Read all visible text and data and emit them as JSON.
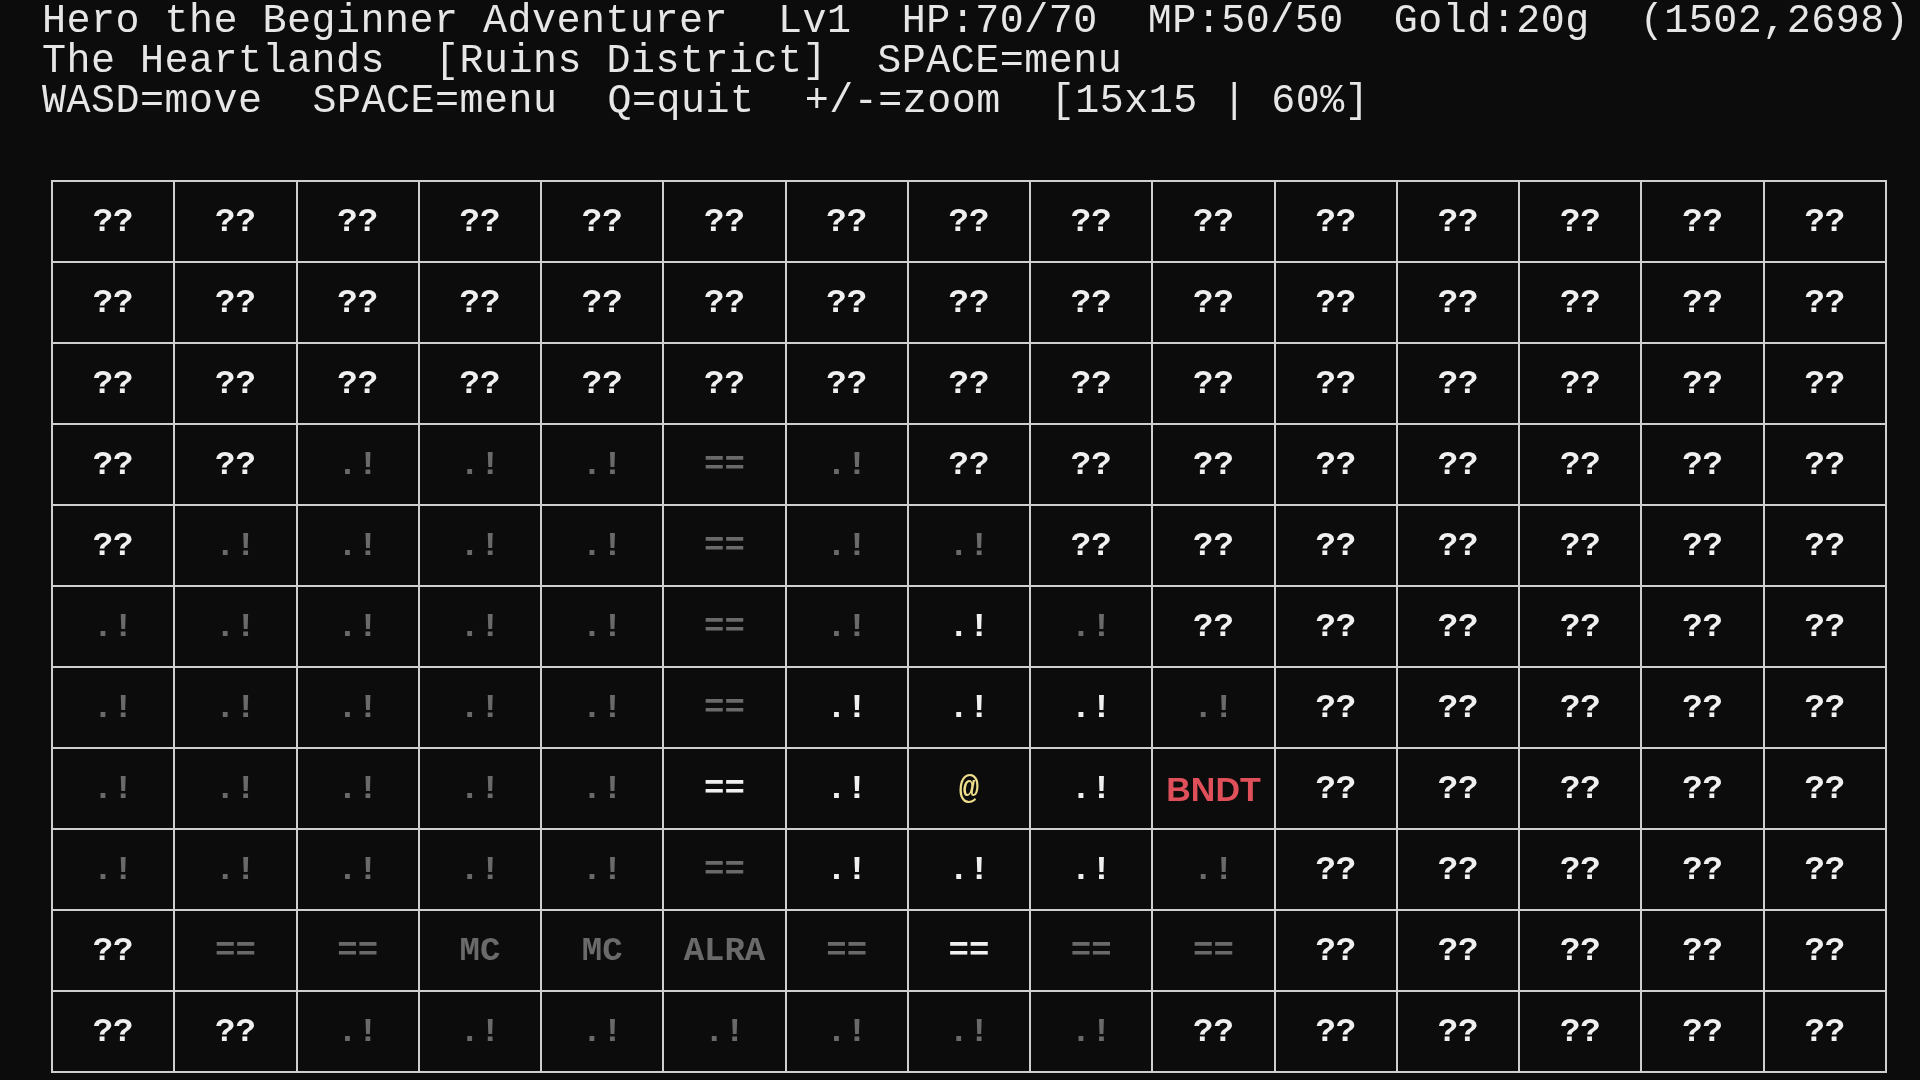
{
  "status_lines": [
    [
      "Hero the Beginner Adventurer",
      "Lv1",
      "HP:70/70",
      "MP:50/50",
      "Gold:20g",
      "(1502,2698)"
    ],
    [
      "The Heartlands",
      "[Ruins District]",
      "SPACE=menu"
    ],
    [
      "WASD=move",
      "SPACE=menu",
      "Q=quit",
      "+/-=zoom",
      "[15x15 | 60%]"
    ]
  ],
  "map": {
    "rows": [
      [
        {
          "text": "??",
          "kind": "tile",
          "visible": true
        },
        {
          "text": "??",
          "kind": "tile",
          "visible": true
        },
        {
          "text": "??",
          "kind": "tile",
          "visible": true
        },
        {
          "text": "??",
          "kind": "tile",
          "visible": true
        },
        {
          "text": "??",
          "kind": "tile",
          "visible": true
        },
        {
          "text": "??",
          "kind": "tile",
          "visible": true
        },
        {
          "text": "??",
          "kind": "tile",
          "visible": true
        },
        {
          "text": "??",
          "kind": "tile",
          "visible": true
        },
        {
          "text": "??",
          "kind": "tile",
          "visible": true
        },
        {
          "text": "??",
          "kind": "tile",
          "visible": true
        },
        {
          "text": "??",
          "kind": "tile",
          "visible": true
        },
        {
          "text": "??",
          "kind": "tile",
          "visible": true
        },
        {
          "text": "??",
          "kind": "tile",
          "visible": true
        },
        {
          "text": "??",
          "kind": "tile",
          "visible": true
        },
        {
          "text": "??",
          "kind": "tile",
          "visible": true
        }
      ],
      [
        {
          "text": "??",
          "kind": "tile",
          "visible": true
        },
        {
          "text": "??",
          "kind": "tile",
          "visible": true
        },
        {
          "text": "??",
          "kind": "tile",
          "visible": true
        },
        {
          "text": "??",
          "kind": "tile",
          "visible": true
        },
        {
          "text": "??",
          "kind": "tile",
          "visible": true
        },
        {
          "text": "??",
          "kind": "tile",
          "visible": true
        },
        {
          "text": "??",
          "kind": "tile",
          "visible": true
        },
        {
          "text": "??",
          "kind": "tile",
          "visible": true
        },
        {
          "text": "??",
          "kind": "tile",
          "visible": true
        },
        {
          "text": "??",
          "kind": "tile",
          "visible": true
        },
        {
          "text": "??",
          "kind": "tile",
          "visible": true
        },
        {
          "text": "??",
          "kind": "tile",
          "visible": true
        },
        {
          "text": "??",
          "kind": "tile",
          "visible": true
        },
        {
          "text": "??",
          "kind": "tile",
          "visible": true
        },
        {
          "text": "??",
          "kind": "tile",
          "visible": true
        }
      ],
      [
        {
          "text": "??",
          "kind": "tile",
          "visible": true
        },
        {
          "text": "??",
          "kind": "tile",
          "visible": true
        },
        {
          "text": "??",
          "kind": "tile",
          "visible": true
        },
        {
          "text": "??",
          "kind": "tile",
          "visible": true
        },
        {
          "text": "??",
          "kind": "tile",
          "visible": true
        },
        {
          "text": "??",
          "kind": "tile",
          "visible": true
        },
        {
          "text": "??",
          "kind": "tile",
          "visible": true
        },
        {
          "text": "??",
          "kind": "tile",
          "visible": true
        },
        {
          "text": "??",
          "kind": "tile",
          "visible": true
        },
        {
          "text": "??",
          "kind": "tile",
          "visible": true
        },
        {
          "text": "??",
          "kind": "tile",
          "visible": true
        },
        {
          "text": "??",
          "kind": "tile",
          "visible": true
        },
        {
          "text": "??",
          "kind": "tile",
          "visible": true
        },
        {
          "text": "??",
          "kind": "tile",
          "visible": true
        },
        {
          "text": "??",
          "kind": "tile",
          "visible": true
        }
      ],
      [
        {
          "text": "??",
          "kind": "tile",
          "visible": true
        },
        {
          "text": "??",
          "kind": "tile",
          "visible": true
        },
        {
          "text": ".!",
          "kind": "tile",
          "visible": false
        },
        {
          "text": ".!",
          "kind": "tile",
          "visible": false
        },
        {
          "text": ".!",
          "kind": "tile",
          "visible": false
        },
        {
          "text": "==",
          "kind": "tile",
          "visible": false
        },
        {
          "text": ".!",
          "kind": "tile",
          "visible": false
        },
        {
          "text": "??",
          "kind": "tile",
          "visible": true
        },
        {
          "text": "??",
          "kind": "tile",
          "visible": true
        },
        {
          "text": "??",
          "kind": "tile",
          "visible": true
        },
        {
          "text": "??",
          "kind": "tile",
          "visible": true
        },
        {
          "text": "??",
          "kind": "tile",
          "visible": true
        },
        {
          "text": "??",
          "kind": "tile",
          "visible": true
        },
        {
          "text": "??",
          "kind": "tile",
          "visible": true
        },
        {
          "text": "??",
          "kind": "tile",
          "visible": true
        }
      ],
      [
        {
          "text": "??",
          "kind": "tile",
          "visible": true
        },
        {
          "text": ".!",
          "kind": "tile",
          "visible": false
        },
        {
          "text": ".!",
          "kind": "tile",
          "visible": false
        },
        {
          "text": ".!",
          "kind": "tile",
          "visible": false
        },
        {
          "text": ".!",
          "kind": "tile",
          "visible": false
        },
        {
          "text": "==",
          "kind": "tile",
          "visible": false
        },
        {
          "text": ".!",
          "kind": "tile",
          "visible": false
        },
        {
          "text": ".!",
          "kind": "tile",
          "visible": false
        },
        {
          "text": "??",
          "kind": "tile",
          "visible": true
        },
        {
          "text": "??",
          "kind": "tile",
          "visible": true
        },
        {
          "text": "??",
          "kind": "tile",
          "visible": true
        },
        {
          "text": "??",
          "kind": "tile",
          "visible": true
        },
        {
          "text": "??",
          "kind": "tile",
          "visible": true
        },
        {
          "text": "??",
          "kind": "tile",
          "visible": true
        },
        {
          "text": "??",
          "kind": "tile",
          "visible": true
        }
      ],
      [
        {
          "text": ".!",
          "kind": "tile",
          "visible": false
        },
        {
          "text": ".!",
          "kind": "tile",
          "visible": false
        },
        {
          "text": ".!",
          "kind": "tile",
          "visible": false
        },
        {
          "text": ".!",
          "kind": "tile",
          "visible": false
        },
        {
          "text": ".!",
          "kind": "tile",
          "visible": false
        },
        {
          "text": "==",
          "kind": "tile",
          "visible": false
        },
        {
          "text": ".!",
          "kind": "tile",
          "visible": false
        },
        {
          "text": ".!",
          "kind": "tile",
          "visible": true
        },
        {
          "text": ".!",
          "kind": "tile",
          "visible": false
        },
        {
          "text": "??",
          "kind": "tile",
          "visible": true
        },
        {
          "text": "??",
          "kind": "tile",
          "visible": true
        },
        {
          "text": "??",
          "kind": "tile",
          "visible": true
        },
        {
          "text": "??",
          "kind": "tile",
          "visible": true
        },
        {
          "text": "??",
          "kind": "tile",
          "visible": true
        },
        {
          "text": "??",
          "kind": "tile",
          "visible": true
        }
      ],
      [
        {
          "text": ".!",
          "kind": "tile",
          "visible": false
        },
        {
          "text": ".!",
          "kind": "tile",
          "visible": false
        },
        {
          "text": ".!",
          "kind": "tile",
          "visible": false
        },
        {
          "text": ".!",
          "kind": "tile",
          "visible": false
        },
        {
          "text": ".!",
          "kind": "tile",
          "visible": false
        },
        {
          "text": "==",
          "kind": "tile",
          "visible": false
        },
        {
          "text": ".!",
          "kind": "tile",
          "visible": true
        },
        {
          "text": ".!",
          "kind": "tile",
          "visible": true
        },
        {
          "text": ".!",
          "kind": "tile",
          "visible": true
        },
        {
          "text": ".!",
          "kind": "tile",
          "visible": false
        },
        {
          "text": "??",
          "kind": "tile",
          "visible": true
        },
        {
          "text": "??",
          "kind": "tile",
          "visible": true
        },
        {
          "text": "??",
          "kind": "tile",
          "visible": true
        },
        {
          "text": "??",
          "kind": "tile",
          "visible": true
        },
        {
          "text": "??",
          "kind": "tile",
          "visible": true
        }
      ],
      [
        {
          "text": ".!",
          "kind": "tile",
          "visible": false
        },
        {
          "text": ".!",
          "kind": "tile",
          "visible": false
        },
        {
          "text": ".!",
          "kind": "tile",
          "visible": false
        },
        {
          "text": ".!",
          "kind": "tile",
          "visible": false
        },
        {
          "text": ".!",
          "kind": "tile",
          "visible": false
        },
        {
          "text": "==",
          "kind": "tile",
          "visible": true
        },
        {
          "text": ".!",
          "kind": "tile",
          "visible": true
        },
        {
          "text": "@",
          "kind": "player",
          "visible": true
        },
        {
          "text": ".!",
          "kind": "tile",
          "visible": true
        },
        {
          "text": "BNDT",
          "kind": "monster",
          "visible": true
        },
        {
          "text": "??",
          "kind": "tile",
          "visible": true
        },
        {
          "text": "??",
          "kind": "tile",
          "visible": true
        },
        {
          "text": "??",
          "kind": "tile",
          "visible": true
        },
        {
          "text": "??",
          "kind": "tile",
          "visible": true
        },
        {
          "text": "??",
          "kind": "tile",
          "visible": true
        }
      ],
      [
        {
          "text": ".!",
          "kind": "tile",
          "visible": false
        },
        {
          "text": ".!",
          "kind": "tile",
          "visible": false
        },
        {
          "text": ".!",
          "kind": "tile",
          "visible": false
        },
        {
          "text": ".!",
          "kind": "tile",
          "visible": false
        },
        {
          "text": ".!",
          "kind": "tile",
          "visible": false
        },
        {
          "text": "==",
          "kind": "tile",
          "visible": false
        },
        {
          "text": ".!",
          "kind": "tile",
          "visible": true
        },
        {
          "text": ".!",
          "kind": "tile",
          "visible": true
        },
        {
          "text": ".!",
          "kind": "tile",
          "visible": true
        },
        {
          "text": ".!",
          "kind": "tile",
          "visible": false
        },
        {
          "text": "??",
          "kind": "tile",
          "visible": true
        },
        {
          "text": "??",
          "kind": "tile",
          "visible": true
        },
        {
          "text": "??",
          "kind": "tile",
          "visible": true
        },
        {
          "text": "??",
          "kind": "tile",
          "visible": true
        },
        {
          "text": "??",
          "kind": "tile",
          "visible": true
        }
      ],
      [
        {
          "text": "??",
          "kind": "tile",
          "visible": true
        },
        {
          "text": "==",
          "kind": "tile",
          "visible": false
        },
        {
          "text": "==",
          "kind": "tile",
          "visible": false
        },
        {
          "text": "MC",
          "kind": "tile",
          "visible": false
        },
        {
          "text": "MC",
          "kind": "tile",
          "visible": false
        },
        {
          "text": "ALRA",
          "kind": "tile",
          "visible": false
        },
        {
          "text": "==",
          "kind": "tile",
          "visible": false
        },
        {
          "text": "==",
          "kind": "tile",
          "visible": true
        },
        {
          "text": "==",
          "kind": "tile",
          "visible": false
        },
        {
          "text": "==",
          "kind": "tile",
          "visible": false
        },
        {
          "text": "??",
          "kind": "tile",
          "visible": true
        },
        {
          "text": "??",
          "kind": "tile",
          "visible": true
        },
        {
          "text": "??",
          "kind": "tile",
          "visible": true
        },
        {
          "text": "??",
          "kind": "tile",
          "visible": true
        },
        {
          "text": "??",
          "kind": "tile",
          "visible": true
        }
      ],
      [
        {
          "text": "??",
          "kind": "tile",
          "visible": true
        },
        {
          "text": "??",
          "kind": "tile",
          "visible": true
        },
        {
          "text": ".!",
          "kind": "tile",
          "visible": false
        },
        {
          "text": ".!",
          "kind": "tile",
          "visible": false
        },
        {
          "text": ".!",
          "kind": "tile",
          "visible": false
        },
        {
          "text": ".!",
          "kind": "tile",
          "visible": false
        },
        {
          "text": ".!",
          "kind": "tile",
          "visible": false
        },
        {
          "text": ".!",
          "kind": "tile",
          "visible": false
        },
        {
          "text": ".!",
          "kind": "tile",
          "visible": false
        },
        {
          "text": "??",
          "kind": "tile",
          "visible": true
        },
        {
          "text": "??",
          "kind": "tile",
          "visible": true
        },
        {
          "text": "??",
          "kind": "tile",
          "visible": true
        },
        {
          "text": "??",
          "kind": "tile",
          "visible": true
        },
        {
          "text": "??",
          "kind": "tile",
          "visible": true
        },
        {
          "text": "??",
          "kind": "tile",
          "visible": true
        }
      ]
    ]
  }
}
